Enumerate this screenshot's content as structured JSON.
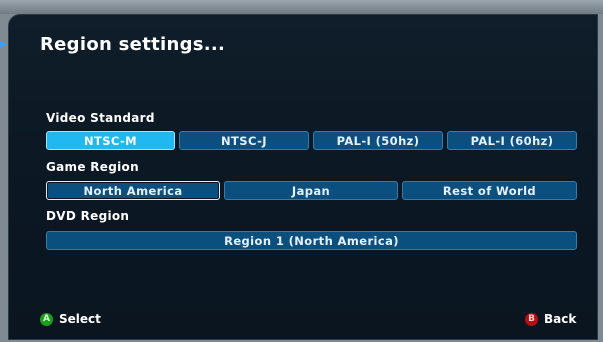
{
  "colors": {
    "panel_bg": "#0b1722",
    "option_bg": "#0b4f7f",
    "option_selected": "#1fb8f0",
    "button_a": "#1aa01a",
    "button_b": "#b01010"
  },
  "title": "Region settings...",
  "video_standard": {
    "label": "Video Standard",
    "options": [
      "NTSC-M",
      "NTSC-J",
      "PAL-I (50hz)",
      "PAL-I (60hz)"
    ],
    "selected": "NTSC-M"
  },
  "game_region": {
    "label": "Game Region",
    "options": [
      "North America",
      "Japan",
      "Rest of World"
    ],
    "selected": "North America"
  },
  "dvd_region": {
    "label": "DVD Region",
    "value": "Region 1 (North America)"
  },
  "footer": {
    "select_badge": "A",
    "select_label": "Select",
    "back_badge": "B",
    "back_label": "Back"
  }
}
